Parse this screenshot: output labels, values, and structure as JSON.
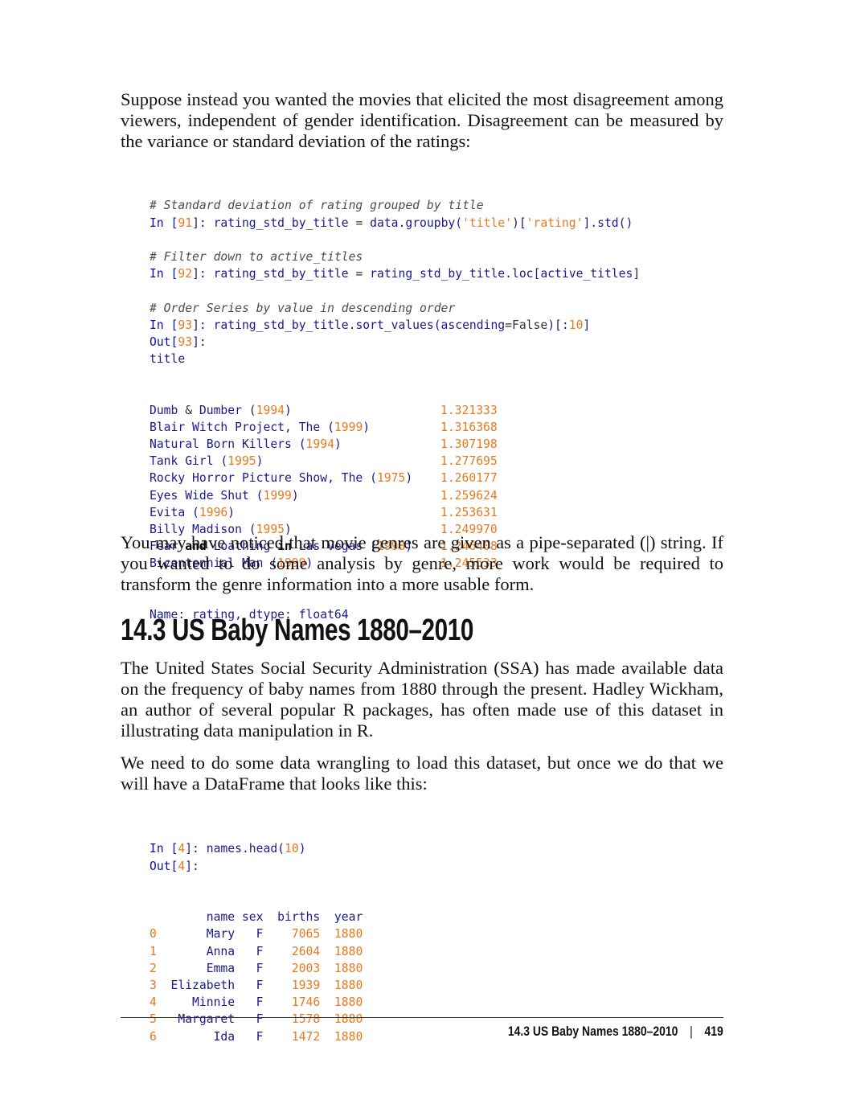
{
  "paragraphs": {
    "p1": "Suppose instead you wanted the movies that elicited the most disagreement among viewers, independent of gender identification. Disagreement can be measured by the variance or standard deviation of the ratings:",
    "p2": "You may have noticed that movie genres are given as a pipe-separated (|) string. If you wanted to do some analysis by genre, more work would be required to transform the genre information into a more usable form.",
    "p3": "The United States Social Security Administration (SSA) has made available data on the frequency of baby names from 1880 through the present. Hadley Wickham, an author of several popular R packages, has often made use of this dataset in illustrating data manipulation in R.",
    "p4": "We need to do some data wrangling to load this dataset, but once we do that we will have a DataFrame that looks like this:"
  },
  "heading": "14.3 US Baby Names 1880–2010",
  "code1": [
    [
      [
        "# Standard deviation of rating grouped by title",
        "c"
      ]
    ],
    [
      [
        "In [",
        "k"
      ],
      [
        "91",
        "o"
      ],
      [
        "]: rating_std_by_title ",
        ""
      ],
      [
        "=",
        "d"
      ],
      [
        " data.groupby(",
        ""
      ],
      [
        "'title'",
        "o"
      ],
      [
        ")[",
        ""
      ],
      [
        "'rating'",
        "o"
      ],
      [
        "].std()",
        ""
      ]
    ],
    [],
    [
      [
        "# Filter down to active_titles",
        "c"
      ]
    ],
    [
      [
        "In [",
        "k"
      ],
      [
        "92",
        "o"
      ],
      [
        "]: rating_std_by_title ",
        ""
      ],
      [
        "=",
        "d"
      ],
      [
        " rating_std_by_title.loc[active_titles]",
        ""
      ]
    ],
    [],
    [
      [
        "# Order Series by value in descending order",
        "c"
      ]
    ],
    [
      [
        "In [",
        "k"
      ],
      [
        "93",
        "o"
      ],
      [
        "]: rating_std_by_title.sort_values(ascending",
        ""
      ],
      [
        "=",
        "d"
      ],
      [
        "False",
        "d"
      ],
      [
        ")[:",
        ""
      ],
      [
        "10",
        "o"
      ],
      [
        "]",
        ""
      ]
    ],
    [
      [
        "Out[",
        "k"
      ],
      [
        "93",
        "o"
      ],
      [
        "]:",
        ""
      ]
    ],
    [
      [
        "title",
        ""
      ]
    ]
  ],
  "series": [
    {
      "title": [
        [
          "Dumb ",
          ""
        ],
        [
          "&",
          "d"
        ],
        [
          " Dumber (",
          ""
        ],
        [
          "1994",
          "o"
        ],
        [
          ")",
          ""
        ]
      ],
      "value": "1.321333"
    },
    {
      "title": [
        [
          "Blair Witch Project, The (",
          ""
        ],
        [
          "1999",
          "o"
        ],
        [
          ")",
          ""
        ]
      ],
      "value": "1.316368"
    },
    {
      "title": [
        [
          "Natural Born Killers (",
          ""
        ],
        [
          "1994",
          "o"
        ],
        [
          ")",
          ""
        ]
      ],
      "value": "1.307198"
    },
    {
      "title": [
        [
          "Tank Girl (",
          ""
        ],
        [
          "1995",
          "o"
        ],
        [
          ")",
          ""
        ]
      ],
      "value": "1.277695"
    },
    {
      "title": [
        [
          "Rocky Horror Picture Show, The (",
          ""
        ],
        [
          "1975",
          "o"
        ],
        [
          ")",
          ""
        ]
      ],
      "value": "1.260177"
    },
    {
      "title": [
        [
          "Eyes Wide Shut (",
          ""
        ],
        [
          "1999",
          "o"
        ],
        [
          ")",
          ""
        ]
      ],
      "value": "1.259624"
    },
    {
      "title": [
        [
          "Evita (",
          ""
        ],
        [
          "1996",
          "o"
        ],
        [
          ")",
          ""
        ]
      ],
      "value": "1.253631"
    },
    {
      "title": [
        [
          "Billy Madison (",
          ""
        ],
        [
          "1995",
          "o"
        ],
        [
          ")",
          ""
        ]
      ],
      "value": "1.249970"
    },
    {
      "title": [
        [
          "Fear ",
          ""
        ],
        [
          "and",
          "b"
        ],
        [
          " Loathing ",
          ""
        ],
        [
          "in",
          "b"
        ],
        [
          " Las Vegas (",
          ""
        ],
        [
          "1998",
          "o"
        ],
        [
          ")",
          ""
        ]
      ],
      "value": "1.246408"
    },
    {
      "title": [
        [
          "Bicentennial Man (",
          ""
        ],
        [
          "1999",
          "o"
        ],
        [
          ")",
          ""
        ]
      ],
      "value": "1.245533"
    }
  ],
  "series_footer": "Name: rating, dtype: float64",
  "code2": [
    [
      [
        "In [",
        "k"
      ],
      [
        "4",
        "o"
      ],
      [
        "]: names.head(",
        ""
      ],
      [
        "10",
        "o"
      ],
      [
        ")",
        ""
      ]
    ],
    [
      [
        "Out[",
        "k"
      ],
      [
        "4",
        "o"
      ],
      [
        "]:",
        ""
      ]
    ]
  ],
  "dataframe": {
    "columns": [
      "name",
      "sex",
      "births",
      "year"
    ],
    "rows": [
      [
        "0",
        "Mary",
        "F",
        "7065",
        "1880"
      ],
      [
        "1",
        "Anna",
        "F",
        "2604",
        "1880"
      ],
      [
        "2",
        "Emma",
        "F",
        "2003",
        "1880"
      ],
      [
        "3",
        "Elizabeth",
        "F",
        "1939",
        "1880"
      ],
      [
        "4",
        "Minnie",
        "F",
        "1746",
        "1880"
      ],
      [
        "5",
        "Margaret",
        "F",
        "1578",
        "1880"
      ],
      [
        "6",
        "Ida",
        "F",
        "1472",
        "1880"
      ]
    ]
  },
  "footer": {
    "section": "14.3 US Baby Names 1880–2010",
    "separator": "|",
    "page": "419"
  }
}
